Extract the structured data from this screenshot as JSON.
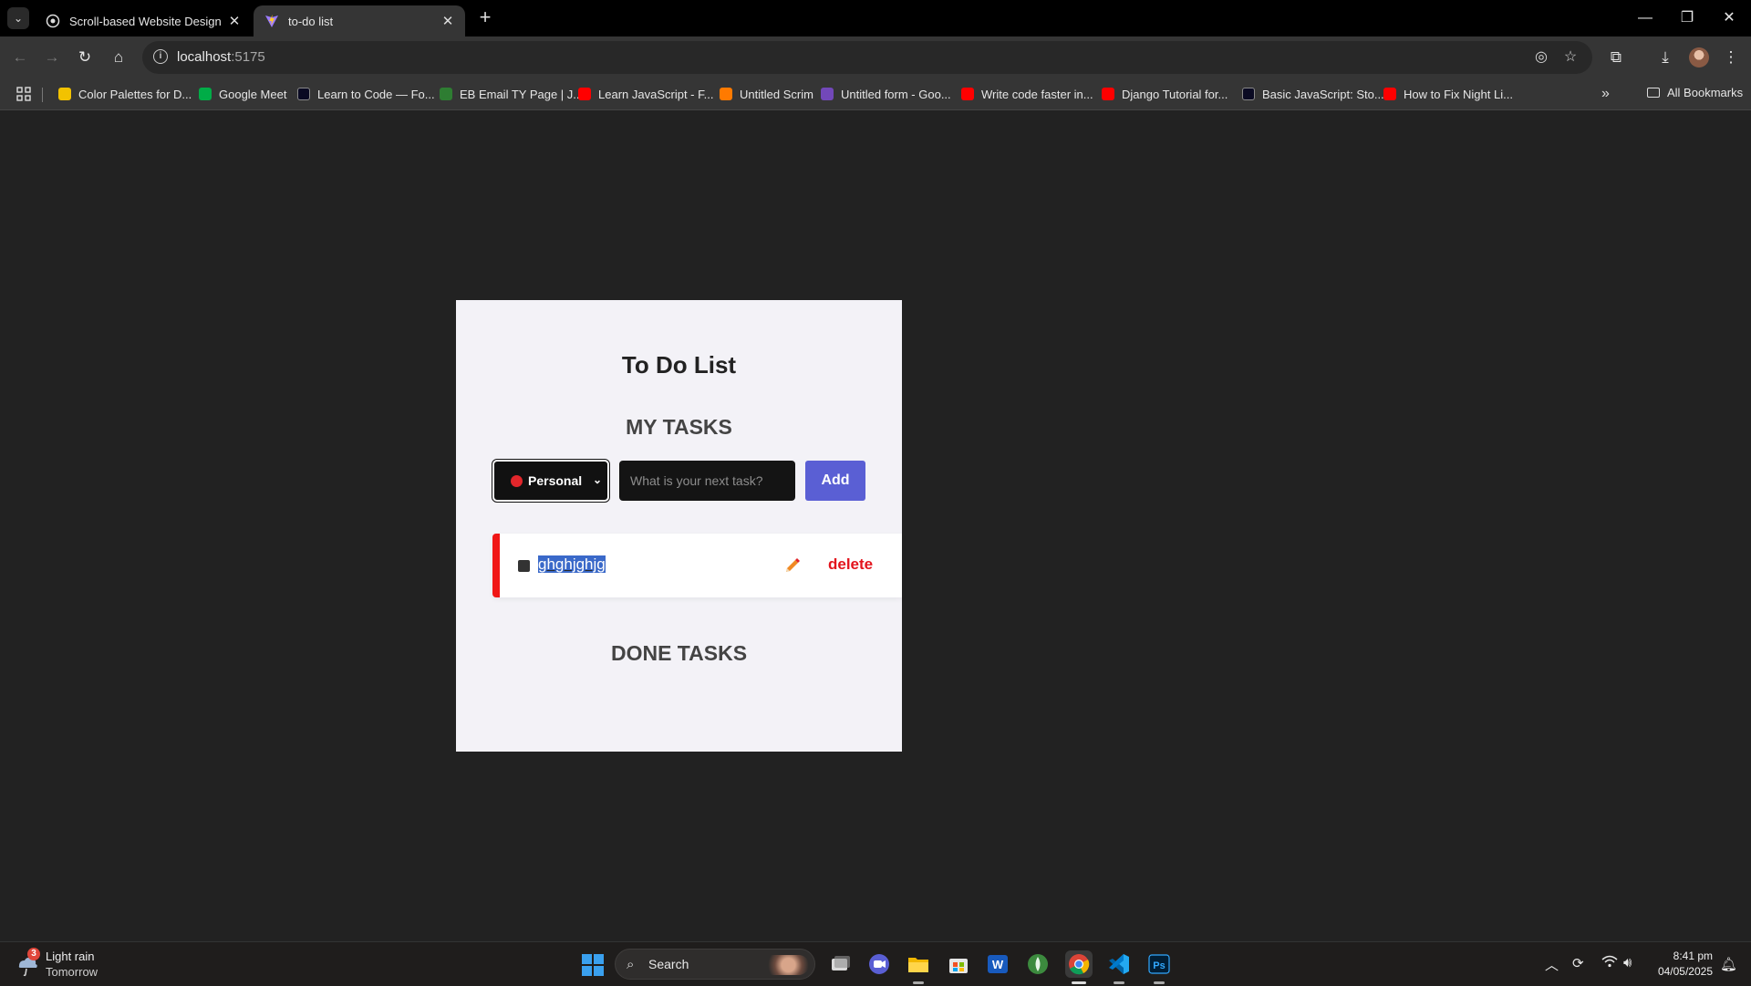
{
  "browser": {
    "tabs": [
      {
        "title": "Scroll-based Website Design",
        "active": false
      },
      {
        "title": "to-do list",
        "active": true
      }
    ],
    "url_host": "localhost",
    "url_port": ":5175",
    "bookmarks": [
      {
        "label": "Color Palettes for D...",
        "color": "#f2c200"
      },
      {
        "label": "Google Meet",
        "color": "#00ac47"
      },
      {
        "label": "Learn to Code — Fo...",
        "color": "#0a0a23"
      },
      {
        "label": "EB Email TY Page | J...",
        "color": "#2e7d32"
      },
      {
        "label": "Learn JavaScript - F...",
        "color": "#ff0000"
      },
      {
        "label": "Untitled Scrim",
        "color": "#ff7a00"
      },
      {
        "label": "Untitled form - Goo...",
        "color": "#7248b9"
      },
      {
        "label": "Write code faster in...",
        "color": "#ff0000"
      },
      {
        "label": "Django Tutorial for...",
        "color": "#ff0000"
      },
      {
        "label": "Basic JavaScript: Sto...",
        "color": "#0a0a23"
      },
      {
        "label": "How to Fix Night Li...",
        "color": "#ff0000"
      }
    ],
    "all_bookmarks": "All Bookmarks"
  },
  "app": {
    "title": "To Do List",
    "my_tasks_heading": "MY TASKS",
    "category_selected": "Personal",
    "category_color": "#e2262b",
    "input_placeholder": "What is your next task?",
    "add_label": "Add",
    "tasks": [
      {
        "text": "ghghjghjg",
        "delete_label": "delete",
        "accent": "#f01616"
      }
    ],
    "done_tasks_heading": "DONE TASKS"
  },
  "taskbar": {
    "weather_badge": "3",
    "weather_line1": "Light rain",
    "weather_line2": "Tomorrow",
    "search_label": "Search",
    "time": "8:41 pm",
    "date": "04/05/2025"
  }
}
